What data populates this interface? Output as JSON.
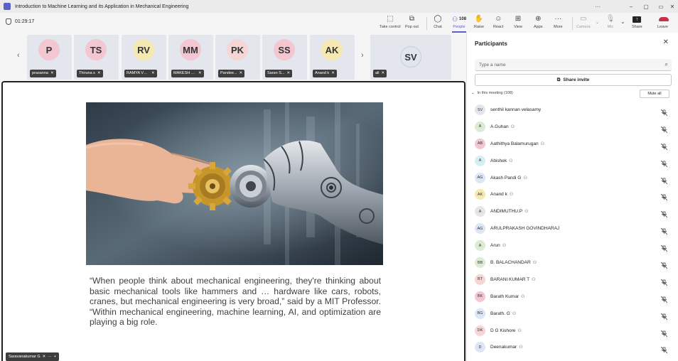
{
  "window": {
    "title": "Introduction to Machine Learning and its Application in Mechanical Engineering",
    "controls": [
      "–",
      "▢",
      "▭",
      "✕"
    ]
  },
  "toolbar": {
    "timer": "01:29:17",
    "buttons": [
      {
        "label": "Take control",
        "icon": "take-control-icon"
      },
      {
        "label": "Pop out",
        "icon": "pop-out-icon"
      },
      {
        "label": "Chat",
        "icon": "chat-icon"
      },
      {
        "label": "People",
        "icon": "people-icon",
        "count": "108"
      },
      {
        "label": "Raise",
        "icon": "raise-hand-icon"
      },
      {
        "label": "React",
        "icon": "react-icon"
      },
      {
        "label": "View",
        "icon": "view-icon"
      },
      {
        "label": "Apps",
        "icon": "apps-icon"
      },
      {
        "label": "More",
        "icon": "more-icon"
      },
      {
        "label": "Camera",
        "icon": "camera-off-icon"
      },
      {
        "label": "Mic",
        "icon": "mic-off-icon"
      },
      {
        "label": "Share",
        "icon": "share-icon"
      },
      {
        "label": "Leave",
        "icon": "leave-icon"
      }
    ]
  },
  "strip": {
    "tiles": [
      {
        "initials": "P",
        "name": "prasanna",
        "color": "#f3c6d1"
      },
      {
        "initials": "TS",
        "name": "Thiruna s",
        "color": "#f3c6d1"
      },
      {
        "initials": "RV",
        "name": "RAMYA VE...",
        "color": "#f6e8b1"
      },
      {
        "initials": "MM",
        "name": "MAKESH M...",
        "color": "#f3c6d1"
      },
      {
        "initials": "PK",
        "name": "Pandee...",
        "color": "#f6d5d5"
      },
      {
        "initials": "SS",
        "name": "Saran S...",
        "color": "#f3c6d1"
      },
      {
        "initials": "AK",
        "name": "Anand k",
        "color": "#f6e8b1"
      }
    ],
    "big_tile": {
      "initials": "SV",
      "name": "all",
      "color": "#e0e6ee"
    }
  },
  "stage": {
    "quote": "“When people think about mechanical engineering, they're thinking about basic mechanical tools like hammers and … hardware like cars, robots, cranes, but mechanical engineering is very broad,” said by a MIT Professor. “Within mechanical engineering, machine learning, AI, and optimization are playing a big role.",
    "presenter": "Saravanakumar G"
  },
  "panel": {
    "title": "Participants",
    "search_placeholder": "Type a name",
    "invite_label": "Share invite",
    "section_label": "In this meeting (108)",
    "mute_all": "Mute all",
    "participants": [
      {
        "initials": "SV",
        "name": "senthil kannan velasamy",
        "ext": false,
        "color": "#e3e6ec"
      },
      {
        "initials": "A",
        "name": "A.Guhan",
        "ext": true,
        "color": "#dcebd4"
      },
      {
        "initials": "AB",
        "name": "Aathithya Balamurugan",
        "ext": true,
        "color": "#f3c6d1"
      },
      {
        "initials": "A",
        "name": "Abishek",
        "ext": true,
        "color": "#d5eef3"
      },
      {
        "initials": "AG",
        "name": "Akash Pandi G",
        "ext": true,
        "color": "#dde6f5"
      },
      {
        "initials": "AK",
        "name": "Anand k",
        "ext": true,
        "color": "#f6e8b1"
      },
      {
        "initials": "A",
        "name": "ANDIMUTHU.P",
        "ext": true,
        "color": "#e6e6e6"
      },
      {
        "initials": "AG",
        "name": "ARULPRAKASH GOVINDHARAJ",
        "ext": false,
        "color": "#dde6f5"
      },
      {
        "initials": "A",
        "name": "Arun",
        "ext": true,
        "color": "#dcebd4"
      },
      {
        "initials": "BB",
        "name": "B. BALACHANDAR",
        "ext": true,
        "color": "#dcebd4"
      },
      {
        "initials": "BT",
        "name": "BARANI KUMAR T",
        "ext": true,
        "color": "#f6d5d5"
      },
      {
        "initials": "BK",
        "name": "Barath Kumar",
        "ext": true,
        "color": "#f3c6d1"
      },
      {
        "initials": "BG",
        "name": "Barath. G",
        "ext": true,
        "color": "#dde6f5"
      },
      {
        "initials": "DK",
        "name": "D G Kishore",
        "ext": true,
        "color": "#f6d5d5"
      },
      {
        "initials": "D",
        "name": "Deenakumar",
        "ext": true,
        "color": "#dde6f5"
      }
    ]
  },
  "colors": {
    "accent": "#5b5fc7",
    "leave": "#c4314b"
  }
}
